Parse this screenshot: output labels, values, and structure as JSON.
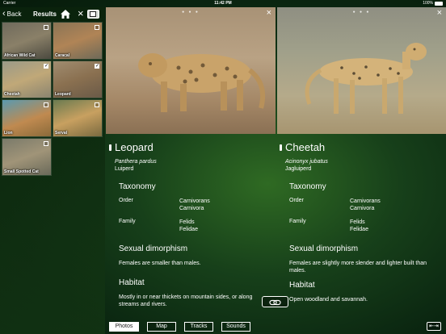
{
  "status": {
    "carrier": "Carrier",
    "time": "11:42 PM",
    "battery": "100%"
  },
  "nav": {
    "back_label": "Back",
    "title": "Results"
  },
  "thumbnails": [
    {
      "label": "African Wild Cat",
      "checked": false
    },
    {
      "label": "Caracal",
      "checked": false
    },
    {
      "label": "Cheetah",
      "checked": true
    },
    {
      "label": "Leopard",
      "checked": true
    },
    {
      "label": "Lion",
      "checked": false
    },
    {
      "label": "Serval",
      "checked": false
    },
    {
      "label": "Small Spotted Cat",
      "checked": false
    }
  ],
  "left": {
    "name": "Leopard",
    "latin": "Panthera pardus",
    "local": "Luiperd",
    "taxonomy_title": "Taxonomy",
    "order_key": "Order",
    "order_v1": "Carnivorans",
    "order_v2": "Carnivora",
    "family_key": "Family",
    "family_v1": "Felids",
    "family_v2": "Felidae",
    "dimorphism_title": "Sexual dimorphism",
    "dimorphism_text": "Females are smaller than males.",
    "habitat_title": "Habitat",
    "habitat_text": "Mostly in or near thickets on mountain sides, or along streams and rivers."
  },
  "right": {
    "name": "Cheetah",
    "latin": "Acinonyx jubatus",
    "local": "Jagluiperd",
    "taxonomy_title": "Taxonomy",
    "order_key": "Order",
    "order_v1": "Carnivorans",
    "order_v2": "Carnivora",
    "family_key": "Family",
    "family_v1": "Felids",
    "family_v2": "Felidae",
    "dimorphism_title": "Sexual dimorphism",
    "dimorphism_text": "Females are slightly more slender and lighter built than males.",
    "habitat_title": "Habitat",
    "habitat_text": "Open woodland and savannah."
  },
  "tabs": [
    "Photos",
    "Map",
    "Tracks",
    "Sounds"
  ],
  "icons": {
    "home": "home-icon",
    "close": "close-icon",
    "compare": "compare-icon",
    "link": "link-icon",
    "swap": "swap-arrows-icon"
  }
}
